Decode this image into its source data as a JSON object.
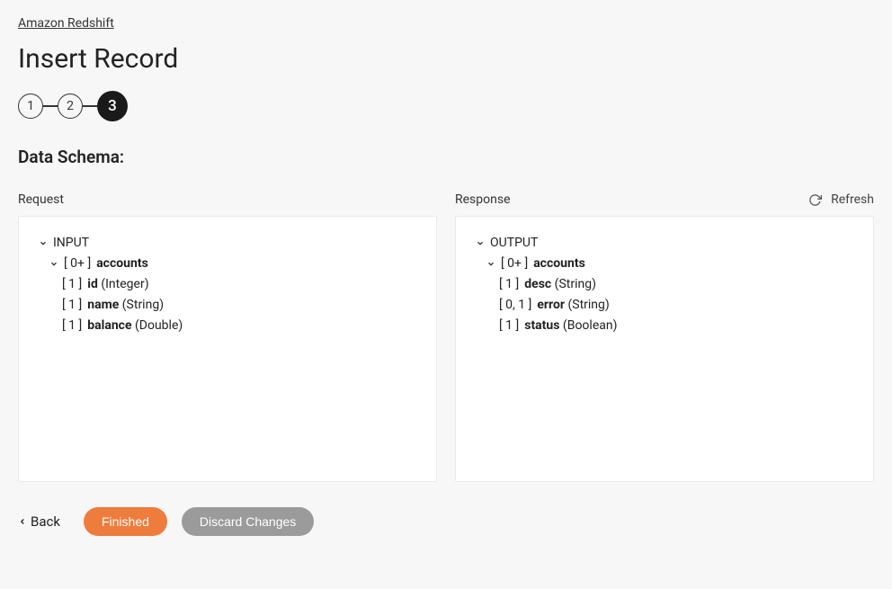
{
  "breadcrumb": {
    "root": "Amazon Redshift"
  },
  "page": {
    "title": "Insert Record"
  },
  "stepper": {
    "steps": [
      "1",
      "2",
      "3"
    ],
    "active_index": 2
  },
  "section": {
    "title": "Data Schema:"
  },
  "refresh": {
    "label": "Refresh"
  },
  "request": {
    "label": "Request",
    "root_label": "INPUT",
    "collection": {
      "cardinality": "[ 0+ ]",
      "name": "accounts"
    },
    "fields": [
      {
        "cardinality": "[ 1 ]",
        "name": "id",
        "type": "Integer"
      },
      {
        "cardinality": "[ 1 ]",
        "name": "name",
        "type": "String"
      },
      {
        "cardinality": "[ 1 ]",
        "name": "balance",
        "type": "Double"
      }
    ]
  },
  "response": {
    "label": "Response",
    "root_label": "OUTPUT",
    "collection": {
      "cardinality": "[ 0+ ]",
      "name": "accounts"
    },
    "fields": [
      {
        "cardinality": "[ 1 ]",
        "name": "desc",
        "type": "String"
      },
      {
        "cardinality": "[ 0, 1 ]",
        "name": "error",
        "type": "String"
      },
      {
        "cardinality": "[ 1 ]",
        "name": "status",
        "type": "Boolean"
      }
    ]
  },
  "footer": {
    "back": "Back",
    "finished": "Finished",
    "discard": "Discard Changes"
  }
}
